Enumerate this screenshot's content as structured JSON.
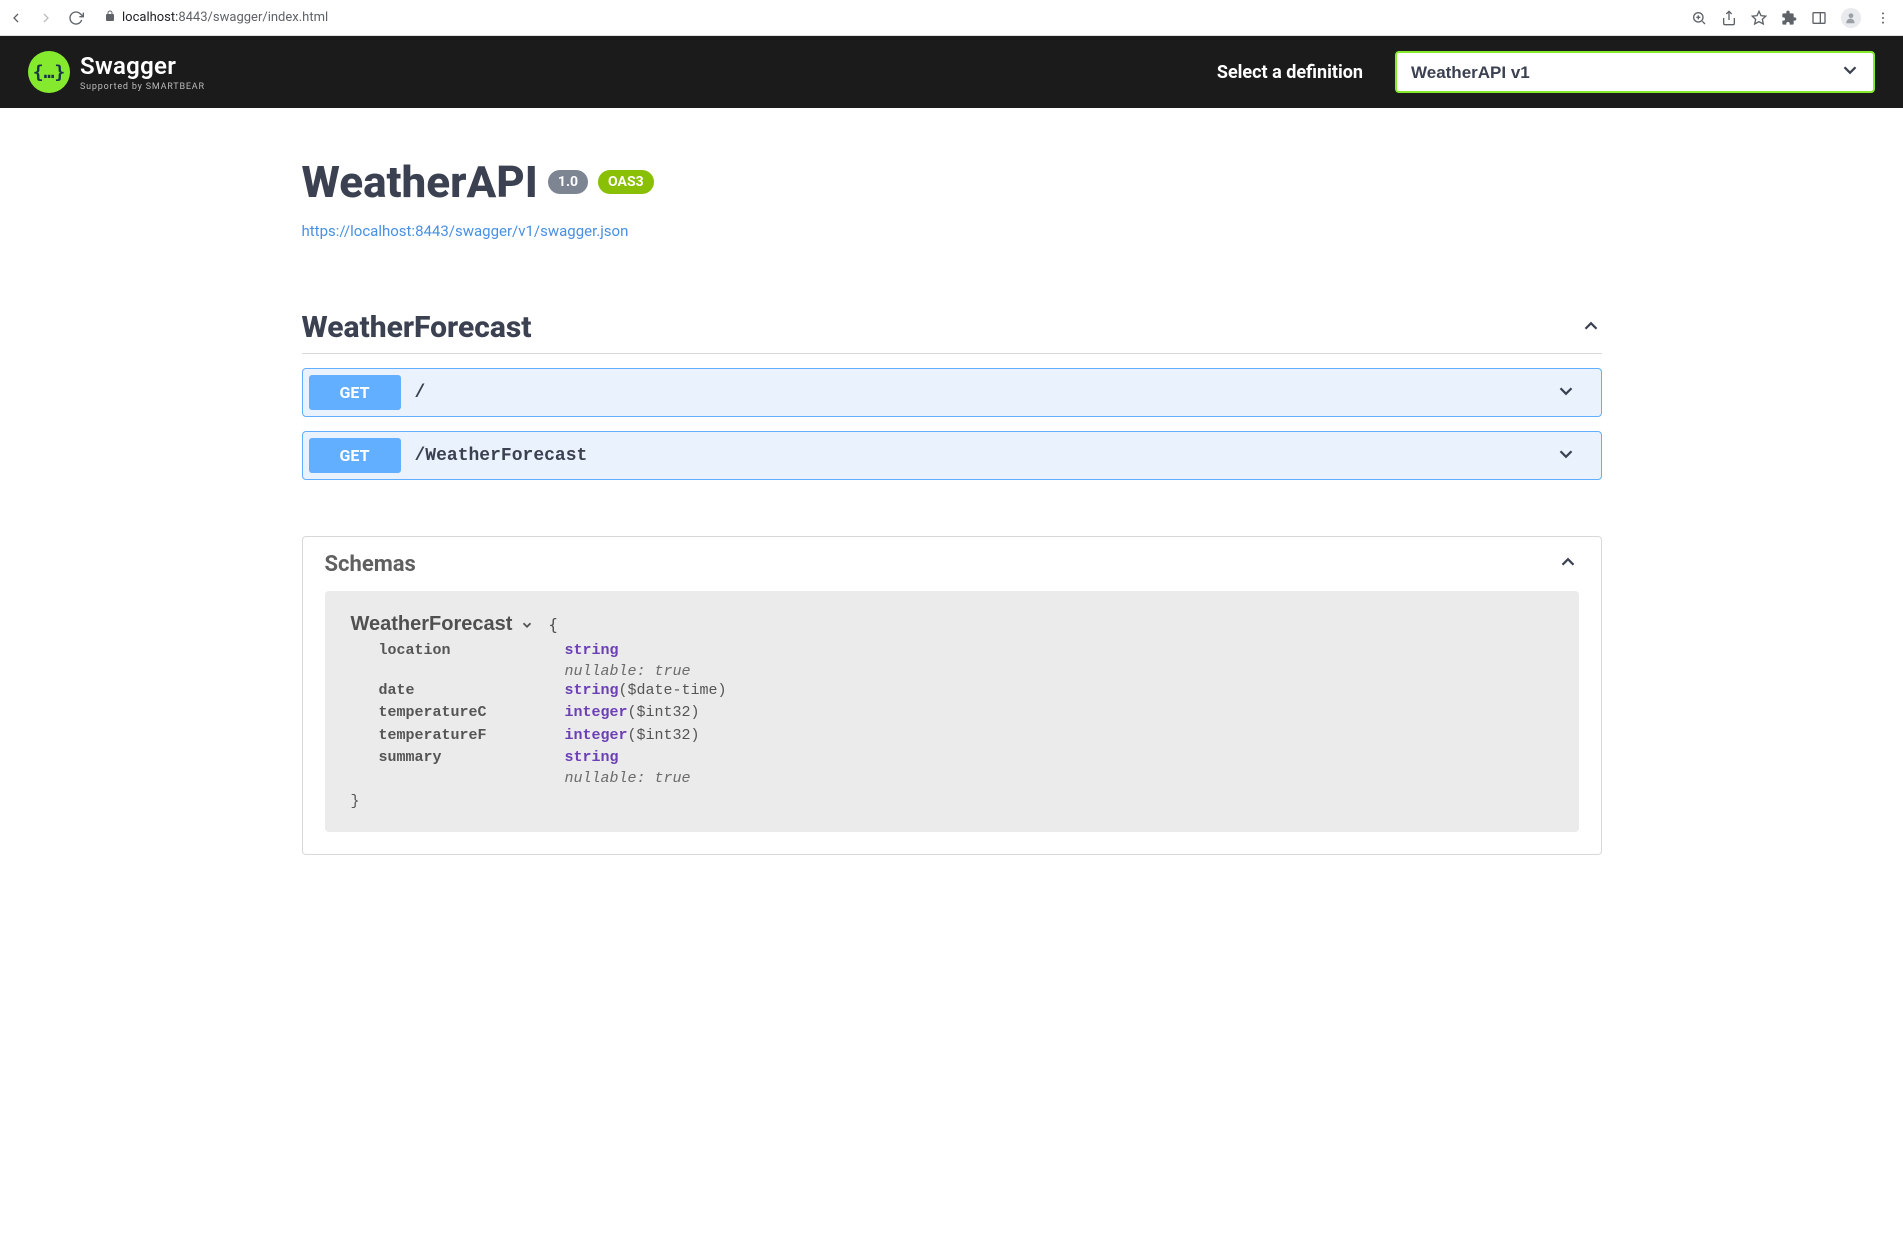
{
  "browser": {
    "url_host": "localhost:",
    "url_port_path": "8443/swagger/index.html"
  },
  "topbar": {
    "brand": "Swagger",
    "brand_sub": "Supported by SMARTBEAR",
    "select_label": "Select a definition",
    "selected_definition": "WeatherAPI v1"
  },
  "info": {
    "title": "WeatherAPI",
    "version": "1.0",
    "oas_badge": "OAS3",
    "spec_url": "https://localhost:8443/swagger/v1/swagger.json"
  },
  "tag": {
    "name": "WeatherForecast",
    "operations": [
      {
        "method": "GET",
        "path": "/"
      },
      {
        "method": "GET",
        "path": "/WeatherForecast"
      }
    ]
  },
  "schemas": {
    "header": "Schemas",
    "model_name": "WeatherForecast",
    "properties": [
      {
        "name": "location",
        "type": "string",
        "format": "",
        "meta": "nullable: true"
      },
      {
        "name": "date",
        "type": "string",
        "format": "($date-time)",
        "meta": ""
      },
      {
        "name": "temperatureC",
        "type": "integer",
        "format": "($int32)",
        "meta": ""
      },
      {
        "name": "temperatureF",
        "type": "integer",
        "format": "($int32)",
        "meta": ""
      },
      {
        "name": "summary",
        "type": "string",
        "format": "",
        "meta": "nullable: true"
      }
    ]
  }
}
